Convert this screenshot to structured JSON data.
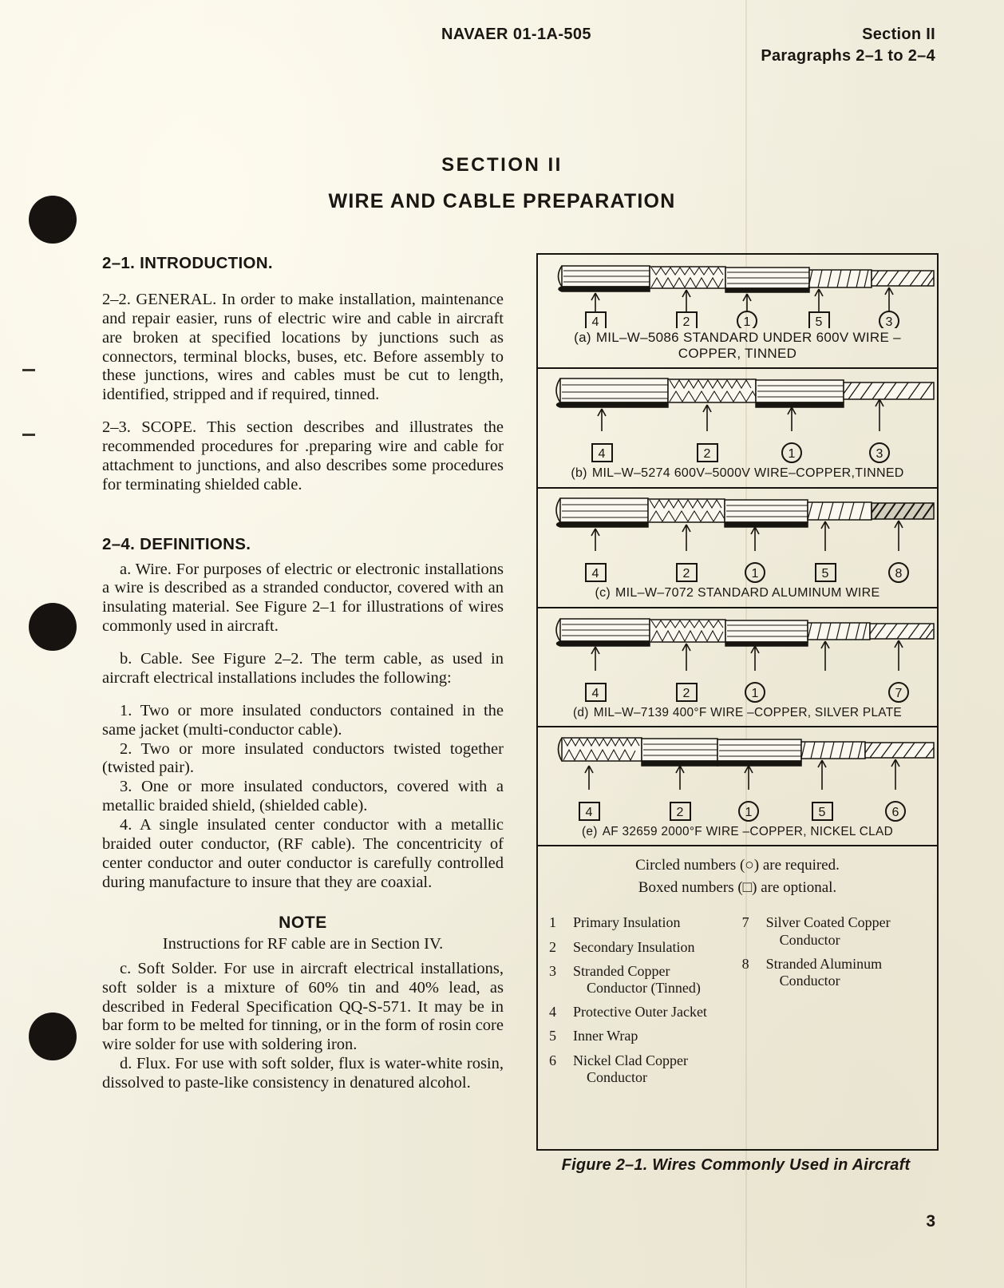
{
  "header": {
    "doc_number": "NAVAER 01-1A-505",
    "section": "Section II",
    "paragraphs": "Paragraphs 2–1 to 2–4"
  },
  "titles": {
    "section": "SECTION  II",
    "subject": "WIRE AND CABLE PREPARATION"
  },
  "body": {
    "h_intro": "2–1.  INTRODUCTION.",
    "p_general": "2–2.  GENERAL.  In order to make installation, maintenance and repair easier, runs of electric wire and cable in aircraft are broken at specified locations by junctions such as connectors, terminal blocks, buses, etc.  Before assembly to these junctions, wires and cables must be cut to length, identified, stripped and if required, tinned.",
    "p_scope": "2–3.  SCOPE.  This section describes and illustrates the recommended procedures for .preparing wire and cable for attachment to junctions, and also describes some procedures for terminating shielded cable.",
    "h_definitions": "2–4.  DEFINITIONS.",
    "p_wire": "a.  Wire.  For purposes of electric or electronic installations a wire is described as a stranded conductor, covered with an insulating material.  See Figure 2–1 for illustrations of wires commonly used in aircraft.",
    "p_cable": "b.  Cable.  See Figure 2–2.  The term cable, as used in aircraft electrical installations includes the following:",
    "list": [
      "1.  Two or more insulated conductors contained in the same jacket (multi-conductor cable).",
      "2.  Two or more insulated conductors twisted together (twisted pair).",
      "3.  One or more insulated conductors, covered with a metallic braided shield, (shielded cable).",
      "4.  A single insulated center conductor with a metallic braided outer conductor, (RF cable).  The concentricity of center conductor and outer conductor is carefully controlled during manufacture to insure that they are coaxial."
    ],
    "note_heading": "NOTE",
    "note_body": "Instructions for RF cable are in Section IV.",
    "p_solder": "c. Soft Solder.  For use in aircraft electrical installations, soft solder is a mixture of 60% tin and 40% lead, as described in Federal Specification QQ-S-571.  It may be in bar form to be melted for tinning, or in the form of rosin core wire solder for use with soldering iron.",
    "p_flux": "d.  Flux.  For use with soft solder, flux is water-white rosin, dissolved to paste-like consistency in denatured alcohol."
  },
  "figure": {
    "panels": [
      {
        "label": "(a)",
        "caption_line1": "MIL–W–5086 STANDARD UNDER 600V WIRE –",
        "caption_line2": "COPPER, TINNED"
      },
      {
        "label": "(b)",
        "caption_line1": "MIL–W–5274  600V–5000V  WIRE–COPPER,TINNED",
        "caption_line2": ""
      },
      {
        "label": "(c)",
        "caption_line1": "MIL–W–7072 STANDARD ALUMINUM WIRE",
        "caption_line2": ""
      },
      {
        "label": "(d)",
        "caption_line1": "MIL–W–7139 400°F WIRE –COPPER, SILVER PLATE",
        "caption_line2": ""
      },
      {
        "label": "(e)",
        "caption_line1": "AF 32659 2000°F WIRE –COPPER, NICKEL CLAD",
        "caption_line2": ""
      }
    ],
    "callouts": {
      "a": [
        {
          "n": "4",
          "shape": "box"
        },
        {
          "n": "2",
          "shape": "box"
        },
        {
          "n": "1",
          "shape": "circle"
        },
        {
          "n": "5",
          "shape": "box"
        },
        {
          "n": "3",
          "shape": "circle"
        }
      ],
      "b": [
        {
          "n": "4",
          "shape": "box"
        },
        {
          "n": "2",
          "shape": "box"
        },
        {
          "n": "1",
          "shape": "circle"
        },
        {
          "n": "3",
          "shape": "circle"
        }
      ],
      "c": [
        {
          "n": "4",
          "shape": "box"
        },
        {
          "n": "2",
          "shape": "box"
        },
        {
          "n": "1",
          "shape": "circle"
        },
        {
          "n": "5",
          "shape": "box"
        },
        {
          "n": "8",
          "shape": "circle"
        }
      ],
      "d": [
        {
          "n": "4",
          "shape": "box"
        },
        {
          "n": "2",
          "shape": "box"
        },
        {
          "n": "1",
          "shape": "circle"
        },
        {
          "n": "7",
          "shape": "circle"
        }
      ],
      "e": [
        {
          "n": "4",
          "shape": "box"
        },
        {
          "n": "2",
          "shape": "box"
        },
        {
          "n": "1",
          "shape": "circle"
        },
        {
          "n": "5",
          "shape": "box"
        },
        {
          "n": "6",
          "shape": "circle"
        }
      ]
    },
    "legend_note_1": "Circled numbers (○) are required.",
    "legend_note_2": "Boxed numbers (□) are optional.",
    "legend_left": [
      {
        "num": "1",
        "text": "Primary Insulation",
        "cont": ""
      },
      {
        "num": "2",
        "text": "Secondary Insulation",
        "cont": ""
      },
      {
        "num": "3",
        "text": "Stranded Copper",
        "cont": "Conductor (Tinned)"
      },
      {
        "num": "4",
        "text": "Protective Outer Jacket",
        "cont": ""
      },
      {
        "num": "5",
        "text": "Inner Wrap",
        "cont": ""
      },
      {
        "num": "6",
        "text": "Nickel Clad Copper",
        "cont": "Conductor"
      }
    ],
    "legend_right": [
      {
        "num": "7",
        "text": "Silver Coated Copper",
        "cont": "Conductor"
      },
      {
        "num": "8",
        "text": "Stranded Aluminum",
        "cont": "Conductor"
      }
    ],
    "caption": "Figure 2–1.  Wires Commonly Used in Aircraft"
  },
  "page_number": "3",
  "colors": {
    "ink": "#17150f",
    "paper": "#f3f0e2"
  }
}
